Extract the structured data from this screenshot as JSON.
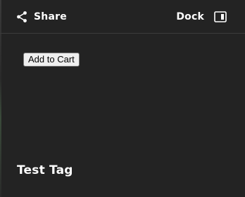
{
  "header": {
    "share_label": "Share",
    "share_icon": "share-icon",
    "dock_label": "Dock",
    "dock_icon": "dock-panel-icon"
  },
  "main": {
    "add_to_cart_label": "Add to Cart"
  },
  "footer": {
    "tag_title": "Test Tag"
  },
  "colors": {
    "background": "#232323",
    "text": "#ffffff",
    "divider": "#3c3c3c"
  }
}
